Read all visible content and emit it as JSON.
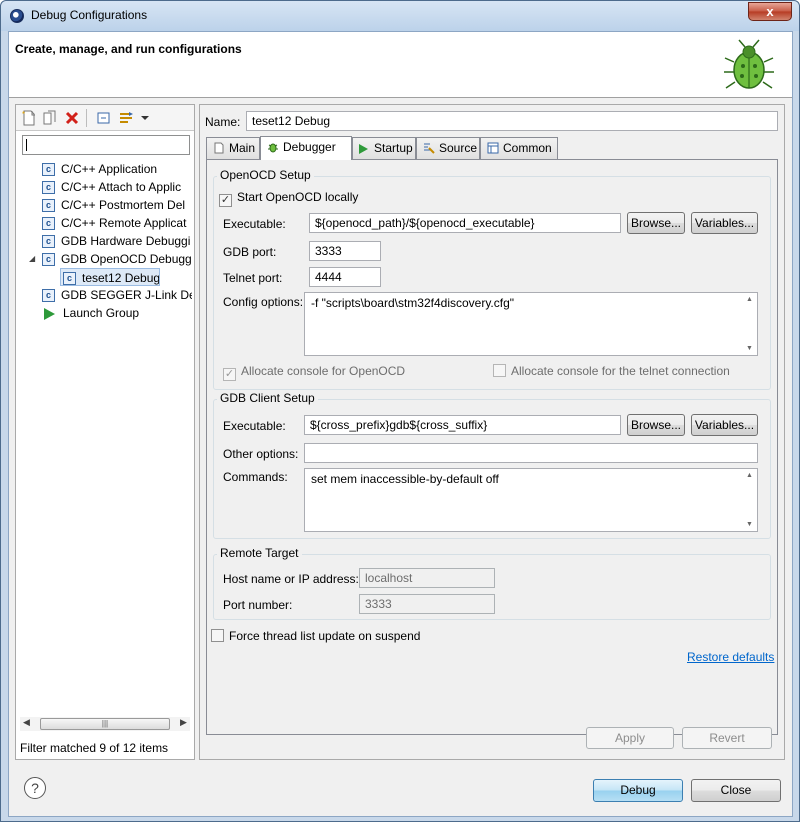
{
  "window": {
    "title": "Debug Configurations",
    "close_label": "x"
  },
  "header": {
    "title": "Create, manage, and run configurations"
  },
  "left": {
    "filter_placeholder": "",
    "tree": [
      {
        "label": "C/C++ Application",
        "icon": "c-config-icon"
      },
      {
        "label": "C/C++ Attach to Applic",
        "icon": "c-config-icon"
      },
      {
        "label": "C/C++ Postmortem Del",
        "icon": "c-config-icon"
      },
      {
        "label": "C/C++ Remote Applicat",
        "icon": "c-config-icon"
      },
      {
        "label": "GDB Hardware Debuggi",
        "icon": "c-config-icon"
      },
      {
        "label": "GDB OpenOCD Debuggi",
        "icon": "c-config-icon",
        "expanded": true
      },
      {
        "label": "teset12 Debug",
        "icon": "c-config-icon",
        "selected": true
      },
      {
        "label": "GDB SEGGER J-Link Deb",
        "icon": "c-config-icon"
      },
      {
        "label": "Launch Group",
        "icon": "launch-icon"
      }
    ],
    "status": "Filter matched 9 of 12 items"
  },
  "right": {
    "name_label": "Name:",
    "name_value": "teset12 Debug",
    "tabs": [
      "Main",
      "Debugger",
      "Startup",
      "Source",
      "Common"
    ],
    "active_tab": "Debugger",
    "openocd": {
      "title": "OpenOCD Setup",
      "start_locally": "Start OpenOCD locally",
      "executable_label": "Executable:",
      "executable_value": "${openocd_path}/${openocd_executable}",
      "gdb_port_label": "GDB port:",
      "gdb_port_value": "3333",
      "telnet_port_label": "Telnet port:",
      "telnet_port_value": "4444",
      "config_label": "Config options:",
      "config_value": "-f \"scripts\\board\\stm32f4discovery.cfg\"",
      "allocate_console": "Allocate console for OpenOCD",
      "allocate_telnet": "Allocate console for the telnet connection"
    },
    "gdb": {
      "title": "GDB Client Setup",
      "executable_label": "Executable:",
      "executable_value": "${cross_prefix}gdb${cross_suffix}",
      "other_label": "Other options:",
      "other_value": "",
      "commands_label": "Commands:",
      "commands_value": "set mem inaccessible-by-default off"
    },
    "remote": {
      "title": "Remote Target",
      "host_label": "Host name or IP address:",
      "host_value": "localhost",
      "port_label": "Port number:",
      "port_value": "3333"
    },
    "force_thread": "Force thread list update on suspend",
    "restore_defaults": "Restore defaults",
    "browse_label": "Browse...",
    "variables_label": "Variables...",
    "apply_label": "Apply",
    "revert_label": "Revert"
  },
  "footer": {
    "help_label": "?",
    "debug_label": "Debug",
    "close_label": "Close"
  },
  "colors": {
    "link": "#0066cc",
    "window_frame": "#c8d8ea",
    "launch_green": "#2e9a3a"
  }
}
